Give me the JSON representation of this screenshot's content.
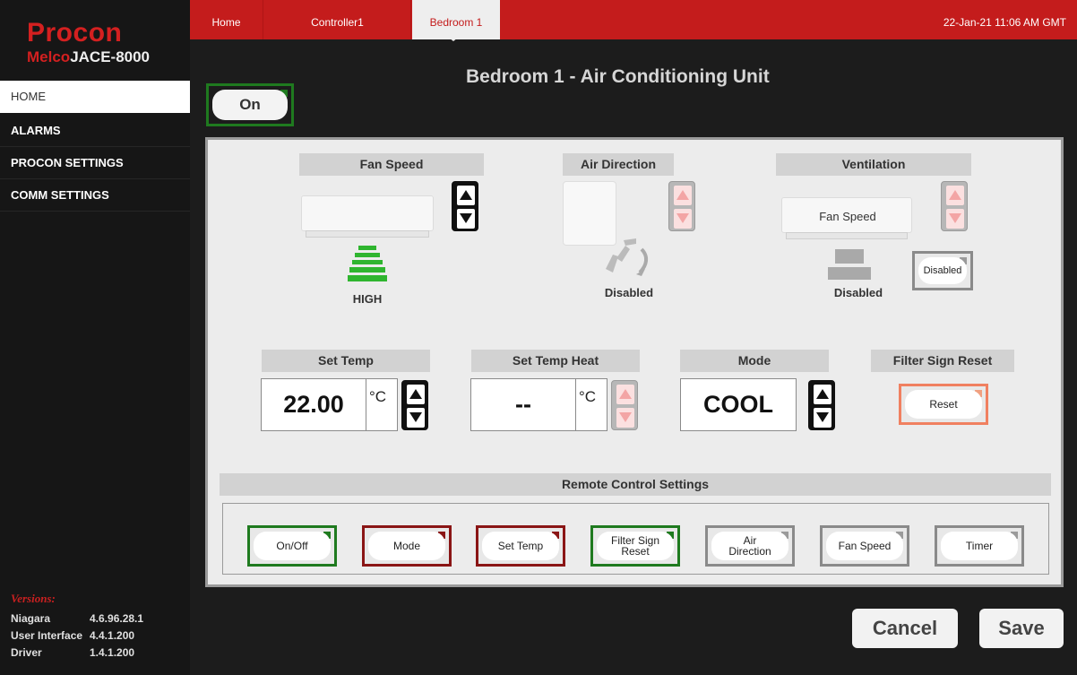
{
  "brand": {
    "name": "Procon",
    "product_prefix": "Melco",
    "product_suffix": "JACE-8000"
  },
  "sidebar": {
    "items": [
      {
        "label": "HOME"
      },
      {
        "label": "ALARMS"
      },
      {
        "label": "PROCON SETTINGS"
      },
      {
        "label": "COMM SETTINGS"
      }
    ]
  },
  "versions": {
    "title": "Versions:",
    "rows": [
      {
        "name": "Niagara",
        "value": "4.6.96.28.1"
      },
      {
        "name": "User Interface",
        "value": "4.4.1.200"
      },
      {
        "name": "Driver",
        "value": "1.4.1.200"
      }
    ]
  },
  "tabs": [
    {
      "label": "Home"
    },
    {
      "label": "Controller1"
    },
    {
      "label": "Bedroom 1"
    }
  ],
  "datetime": "22-Jan-21 11:06 AM GMT",
  "page_title": "Bedroom 1 - Air Conditioning Unit",
  "power": {
    "label": "On"
  },
  "fan_speed": {
    "header": "Fan Speed",
    "value": "HIGH"
  },
  "air_direction": {
    "header": "Air Direction",
    "value": "Disabled"
  },
  "ventilation": {
    "header": "Ventilation",
    "unit_label": "Fan Speed",
    "value": "Disabled",
    "button": "Disabled"
  },
  "set_temp": {
    "header": "Set Temp",
    "value": "22.00",
    "unit": "°C"
  },
  "set_temp_heat": {
    "header": "Set Temp Heat",
    "value": "--",
    "unit": "°C"
  },
  "mode": {
    "header": "Mode",
    "value": "COOL"
  },
  "filter": {
    "header": "Filter Sign Reset",
    "button": "Reset"
  },
  "remote": {
    "header": "Remote Control Settings",
    "buttons": [
      {
        "label": "On/Off",
        "state": "green"
      },
      {
        "label": "Mode",
        "state": "red"
      },
      {
        "label": "Set Temp",
        "state": "red"
      },
      {
        "label": "Filter Sign Reset",
        "state": "green"
      },
      {
        "label": "Air Direction",
        "state": "grey"
      },
      {
        "label": "Fan Speed",
        "state": "grey"
      },
      {
        "label": "Timer",
        "state": "grey"
      }
    ]
  },
  "actions": {
    "cancel": "Cancel",
    "save": "Save"
  },
  "colors": {
    "brand_red": "#c41c1c",
    "green": "#1f7a1f",
    "dark_red": "#8a1515",
    "fan_bars": "#2fb52f",
    "reset_border": "#f08060"
  }
}
